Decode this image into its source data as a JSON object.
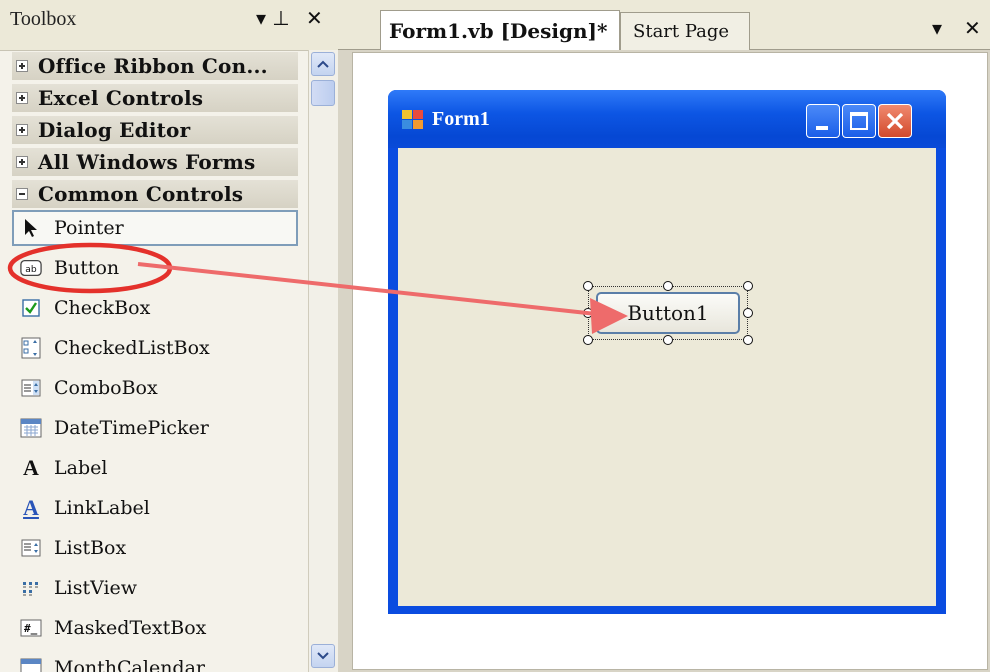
{
  "toolbox": {
    "title": "Toolbox",
    "pin_glyph": "▾ ⊥",
    "close_glyph": "✕",
    "categories": [
      {
        "label": "Office Ribbon Con...",
        "expanded": false
      },
      {
        "label": "Excel Controls",
        "expanded": false
      },
      {
        "label": "Dialog Editor",
        "expanded": false
      },
      {
        "label": "All Windows Forms",
        "expanded": false
      },
      {
        "label": "Common Controls",
        "expanded": true
      }
    ],
    "items": [
      {
        "label": "Pointer",
        "icon": "pointer-icon",
        "selected": true
      },
      {
        "label": "Button",
        "icon": "button-icon"
      },
      {
        "label": "CheckBox",
        "icon": "checkbox-icon"
      },
      {
        "label": "CheckedListBox",
        "icon": "checkedlistbox-icon"
      },
      {
        "label": "ComboBox",
        "icon": "combobox-icon"
      },
      {
        "label": "DateTimePicker",
        "icon": "datetimepicker-icon"
      },
      {
        "label": "Label",
        "icon": "label-icon"
      },
      {
        "label": "LinkLabel",
        "icon": "linklabel-icon"
      },
      {
        "label": "ListBox",
        "icon": "listbox-icon"
      },
      {
        "label": "ListView",
        "icon": "listview-icon"
      },
      {
        "label": "MaskedTextBox",
        "icon": "maskedtextbox-icon"
      },
      {
        "label": "MonthCalendar",
        "icon": "monthcalendar-icon"
      }
    ]
  },
  "tabs": {
    "design": "Form1.vb [Design]*",
    "start": "Start Page",
    "dropdown_glyph": "▾",
    "close_glyph": "✕"
  },
  "form": {
    "title": "Form1",
    "button_text": "Button1"
  },
  "colors": {
    "annotation": "#e4312b",
    "arrow": "#ee6b6b",
    "titlebar": "#0a4ce0"
  }
}
